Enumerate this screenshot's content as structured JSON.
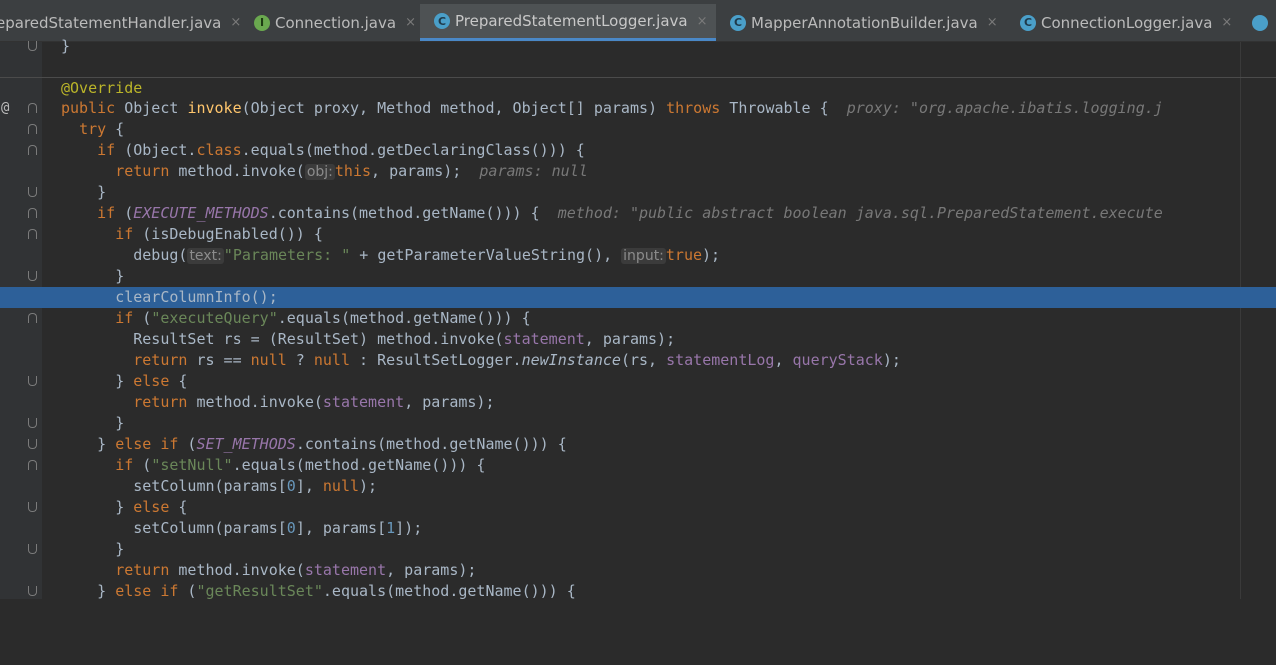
{
  "tabs": [
    {
      "label": "eparedStatementHandler.java",
      "icon": "none",
      "active": false
    },
    {
      "label": "Connection.java",
      "icon": "interface-icon",
      "icon_glyph": "I",
      "active": false
    },
    {
      "label": "PreparedStatementLogger.java",
      "icon": "class-icon",
      "icon_glyph": "C",
      "active": true
    },
    {
      "label": "MapperAnnotationBuilder.java",
      "icon": "class-icon",
      "icon_glyph": "C",
      "active": false
    },
    {
      "label": "ConnectionLogger.java",
      "icon": "class-icon",
      "icon_glyph": "C",
      "active": false
    }
  ],
  "tab_close_glyph": "×",
  "gutter": {
    "override_marker": "@"
  },
  "colors": {
    "background": "#2b2b2b",
    "keyword": "#cc7832",
    "string": "#6a8759",
    "field": "#9876aa",
    "method": "#ffc66d",
    "annotation": "#bbb529",
    "selection": "#2d6099"
  },
  "code": {
    "l0": {
      "text": "}"
    },
    "l1": {
      "anno": "@Override"
    },
    "l2": {
      "kw1": "public",
      "t1": " Object ",
      "fn": "invoke",
      "t2": "(Object proxy, Method method, Object[] params) ",
      "kw2": "throws",
      "t3": " Throwable {",
      "hint": "proxy: \"org.apache.ibatis.logging.j"
    },
    "l3": {
      "kw": "try",
      "t1": " {"
    },
    "l4": {
      "kw": "if",
      "t1": " (Object.",
      "kw2": "class",
      "t2": ".equals(method.getDeclaringClass())) {"
    },
    "l5": {
      "kw": "return",
      "t1": " method.invoke(",
      "ph": "obj:",
      "kw2": "this",
      "t2": ", params);",
      "hint": "params: null"
    },
    "l6": {
      "text": "}"
    },
    "l7": {
      "kw": "if",
      "t1": " (",
      "sf": "EXECUTE_METHODS",
      "t2": ".contains(method.getName())) {",
      "hint": "method: \"public abstract boolean java.sql.PreparedStatement.execute"
    },
    "l8": {
      "kw": "if",
      "t1": " (isDebugEnabled()) {"
    },
    "l9": {
      "t1": "debug(",
      "ph1": "text:",
      "s": "\"Parameters: \"",
      "t2": " + getParameterValueString(), ",
      "ph2": "input:",
      "kw": "true",
      "t3": ");"
    },
    "l10": {
      "text": "}"
    },
    "l11": {
      "text": "clearColumnInfo();"
    },
    "l12": {
      "kw": "if",
      "t1": " (",
      "s": "\"executeQuery\"",
      "t2": ".equals(method.getName())) {"
    },
    "l13": {
      "t1": "ResultSet rs = (ResultSet) method.invoke(",
      "f": "statement",
      "t2": ", params);"
    },
    "l14": {
      "kw": "return",
      "t1": " rs == ",
      "kw2": "null",
      "t2": " ? ",
      "kw3": "null",
      "t3": " : ResultSetLogger.",
      "it": "newInstance",
      "t4": "(rs, ",
      "f1": "statementLog",
      "t5": ", ",
      "f2": "queryStack",
      "t6": ");"
    },
    "l15": {
      "t1": "} ",
      "kw": "else",
      "t2": " {"
    },
    "l16": {
      "kw": "return",
      "t1": " method.invoke(",
      "f": "statement",
      "t2": ", params);"
    },
    "l17": {
      "text": "}"
    },
    "l18": {
      "t1": "} ",
      "kw": "else if",
      "t2": " (",
      "sf": "SET_METHODS",
      "t3": ".contains(method.getName())) {"
    },
    "l19": {
      "kw": "if",
      "t1": " (",
      "s": "\"setNull\"",
      "t2": ".equals(method.getName())) {"
    },
    "l20": {
      "t1": "setColumn(params[",
      "n": "0",
      "t2": "], ",
      "kw": "null",
      "t3": ");"
    },
    "l21": {
      "t1": "} ",
      "kw": "else",
      "t2": " {"
    },
    "l22": {
      "t1": "setColumn(params[",
      "n1": "0",
      "t2": "], params[",
      "n2": "1",
      "t3": "]);"
    },
    "l23": {
      "text": "}"
    },
    "l24": {
      "kw": "return",
      "t1": " method.invoke(",
      "f": "statement",
      "t2": ", params);"
    },
    "l25": {
      "t1": "} ",
      "kw": "else if",
      "t2": " (",
      "s": "\"getResultSet\"",
      "t3": ".equals(method.getName())) {"
    }
  }
}
